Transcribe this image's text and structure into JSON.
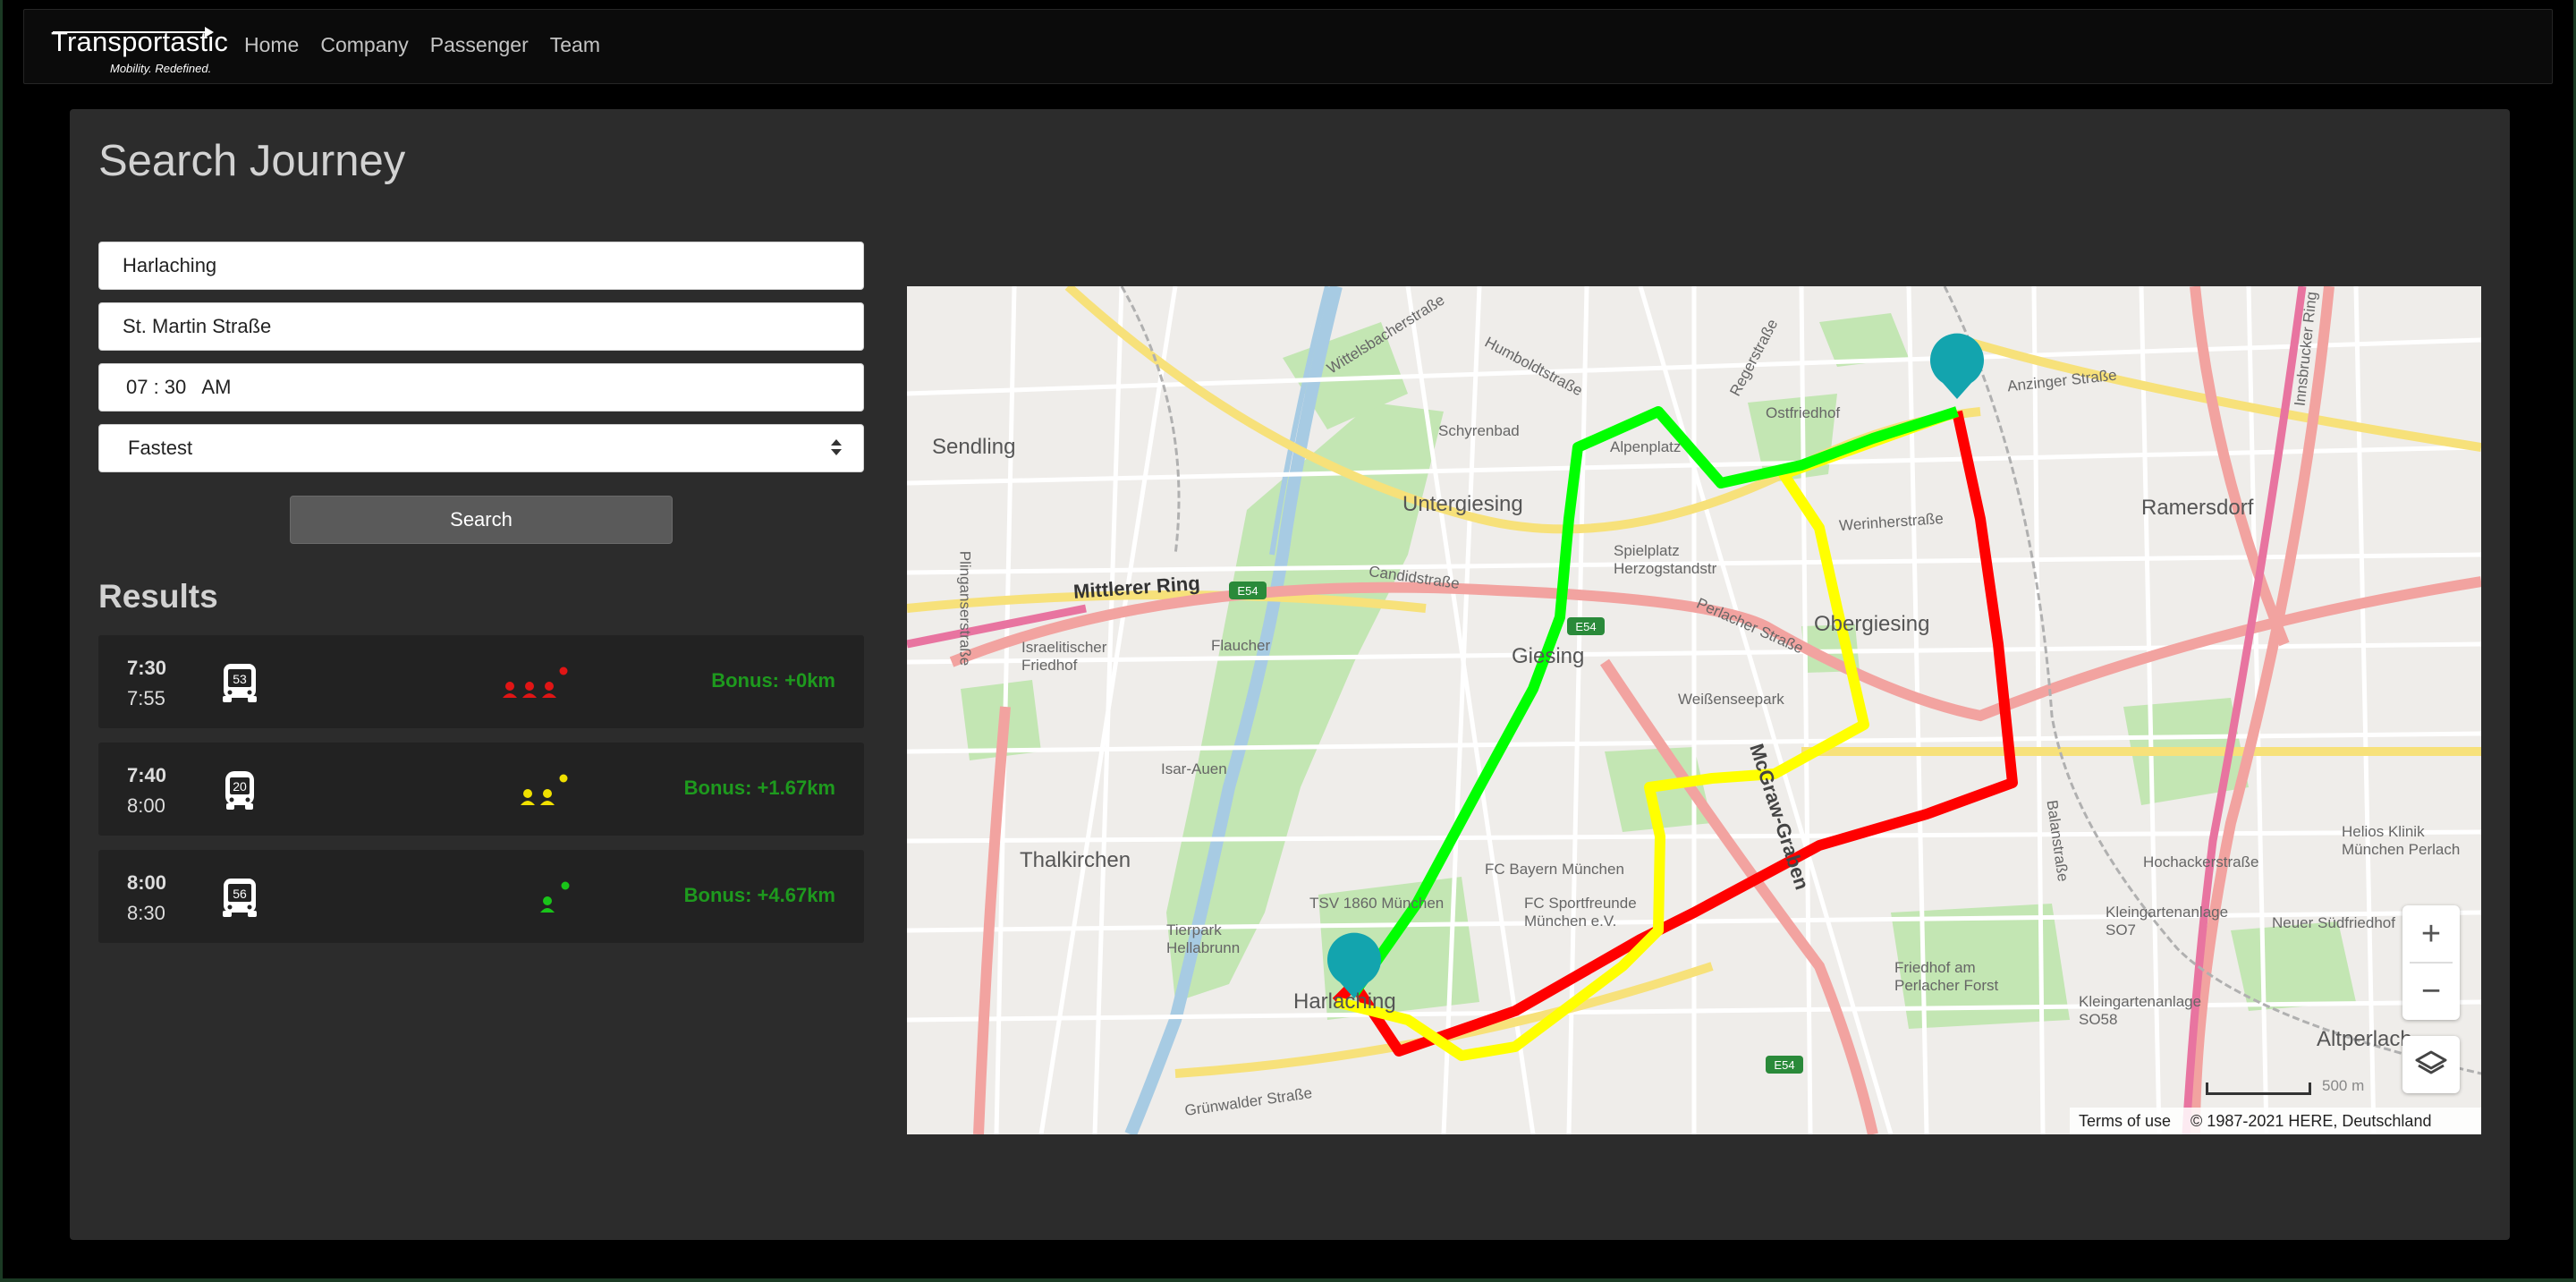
{
  "brand": {
    "name": "Transportastic",
    "tagline": "Mobility. Redefined."
  },
  "nav": {
    "items": [
      "Home",
      "Company",
      "Passenger",
      "Team"
    ]
  },
  "page": {
    "title": "Search Journey"
  },
  "form": {
    "from_value": "Harlaching",
    "to_value": "St. Martin Straße",
    "time_value": "07 : 30   AM",
    "mode_value": "Fastest",
    "search_label": "Search"
  },
  "results": {
    "title": "Results",
    "items": [
      {
        "departure": "7:30",
        "arrival": "7:55",
        "bus": "53",
        "crowd_level": 3,
        "crowd_color": "#e01515",
        "bonus": "Bonus: +0km"
      },
      {
        "departure": "7:40",
        "arrival": "8:00",
        "bus": "20",
        "crowd_level": 2,
        "crowd_color": "#f0e000",
        "bonus": "Bonus: +1.67km"
      },
      {
        "departure": "8:00",
        "arrival": "8:30",
        "bus": "56",
        "crowd_level": 1,
        "crowd_color": "#19c419",
        "bonus": "Bonus: +4.67km"
      }
    ]
  },
  "map": {
    "route_colors": {
      "fastest": "#ff0000",
      "medium": "#ffff00",
      "green": "#00ff00"
    },
    "marker_color": "#13a4ae",
    "labels": {
      "sendling": "Sendling",
      "untergiesing": "Untergiesing",
      "ramersdorf": "Ramersdorf",
      "obergiesing": "Obergiesing",
      "giesing": "Giesing",
      "thalkirchen": "Thalkirchen",
      "harlaching": "Harlaching",
      "altperlach": "Altperlach",
      "mittlerer_ring": "Mittlerer Ring",
      "flaucher": "Flaucher",
      "alpenplatz": "Alpenplatz",
      "schyrenbad": "Schyrenbad",
      "ostfriedhof": "Ostfriedhof",
      "werinherstrasse": "Werinherstraße",
      "anzinger": "Anzinger Straße",
      "mcgraw": "McGraw-Graben",
      "fc_bayern": "FC Bayern München",
      "tsv1860": "TSV 1860 München",
      "tierpark": "Tierpark Hellabrunn",
      "weissenseepark": "Weißenseepark",
      "friedhof_perlach": "Friedhof am Perlacher Forst",
      "helios": "Helios Klinik München Perlach",
      "hochacker": "Hochackerstraße",
      "gruenwalder": "Grünwalder Straße",
      "candidstrasse": "Candidstraße",
      "israelitischer": "Israelitischer Friedhof",
      "spielplatz": "Spielplatz Herzogstandstr",
      "perlacher": "Perlacher Straße",
      "isar_auen": "Isar-Auen",
      "neuer_suedfriedhof": "Neuer Südfriedhof",
      "plinganser": "Plinganserstraße",
      "kleingarten_s07": "Kleingartenanlage SO7",
      "kleingarten_s058": "Kleingartenanlage SO58",
      "humboldt": "Humboldtstraße",
      "wittelsbacher": "Wittelsbacherstraße",
      "regerstrasse": "Regerstraße",
      "balanstrasse": "Balanstraße",
      "innsbrucker": "Innsbrucker Ring",
      "fc_sportfreunde": "FC Sportfreunde München e.V.",
      "e54": "E54"
    },
    "zoom_in": "+",
    "zoom_out": "−",
    "scale": "500 m",
    "terms": "Terms of use",
    "copyright": "© 1987-2021 HERE, Deutschland"
  }
}
